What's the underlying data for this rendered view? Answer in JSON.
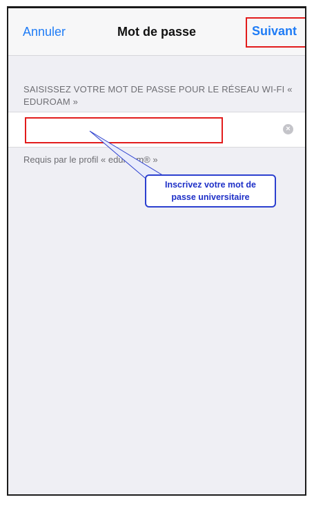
{
  "navbar": {
    "cancel_label": "Annuler",
    "title": "Mot de passe",
    "next_label": "Suivant"
  },
  "form": {
    "section_header": "SAISISSEZ VOTRE MOT DE PASSE POUR LE RÉSEAU WI-FI « EDUROAM »",
    "password_value": "",
    "footer_note": "Requis par le profil « eduroam® »"
  },
  "annotation": {
    "callout_line1": "Inscrivez votre mot de",
    "callout_line2": "passe universitaire"
  },
  "colors": {
    "accent": "#1f7cf6",
    "highlight": "#e21b1b",
    "callout": "#2b3fcf",
    "background": "#efeff4"
  },
  "icons": {
    "clear": "clear-circle-icon"
  }
}
